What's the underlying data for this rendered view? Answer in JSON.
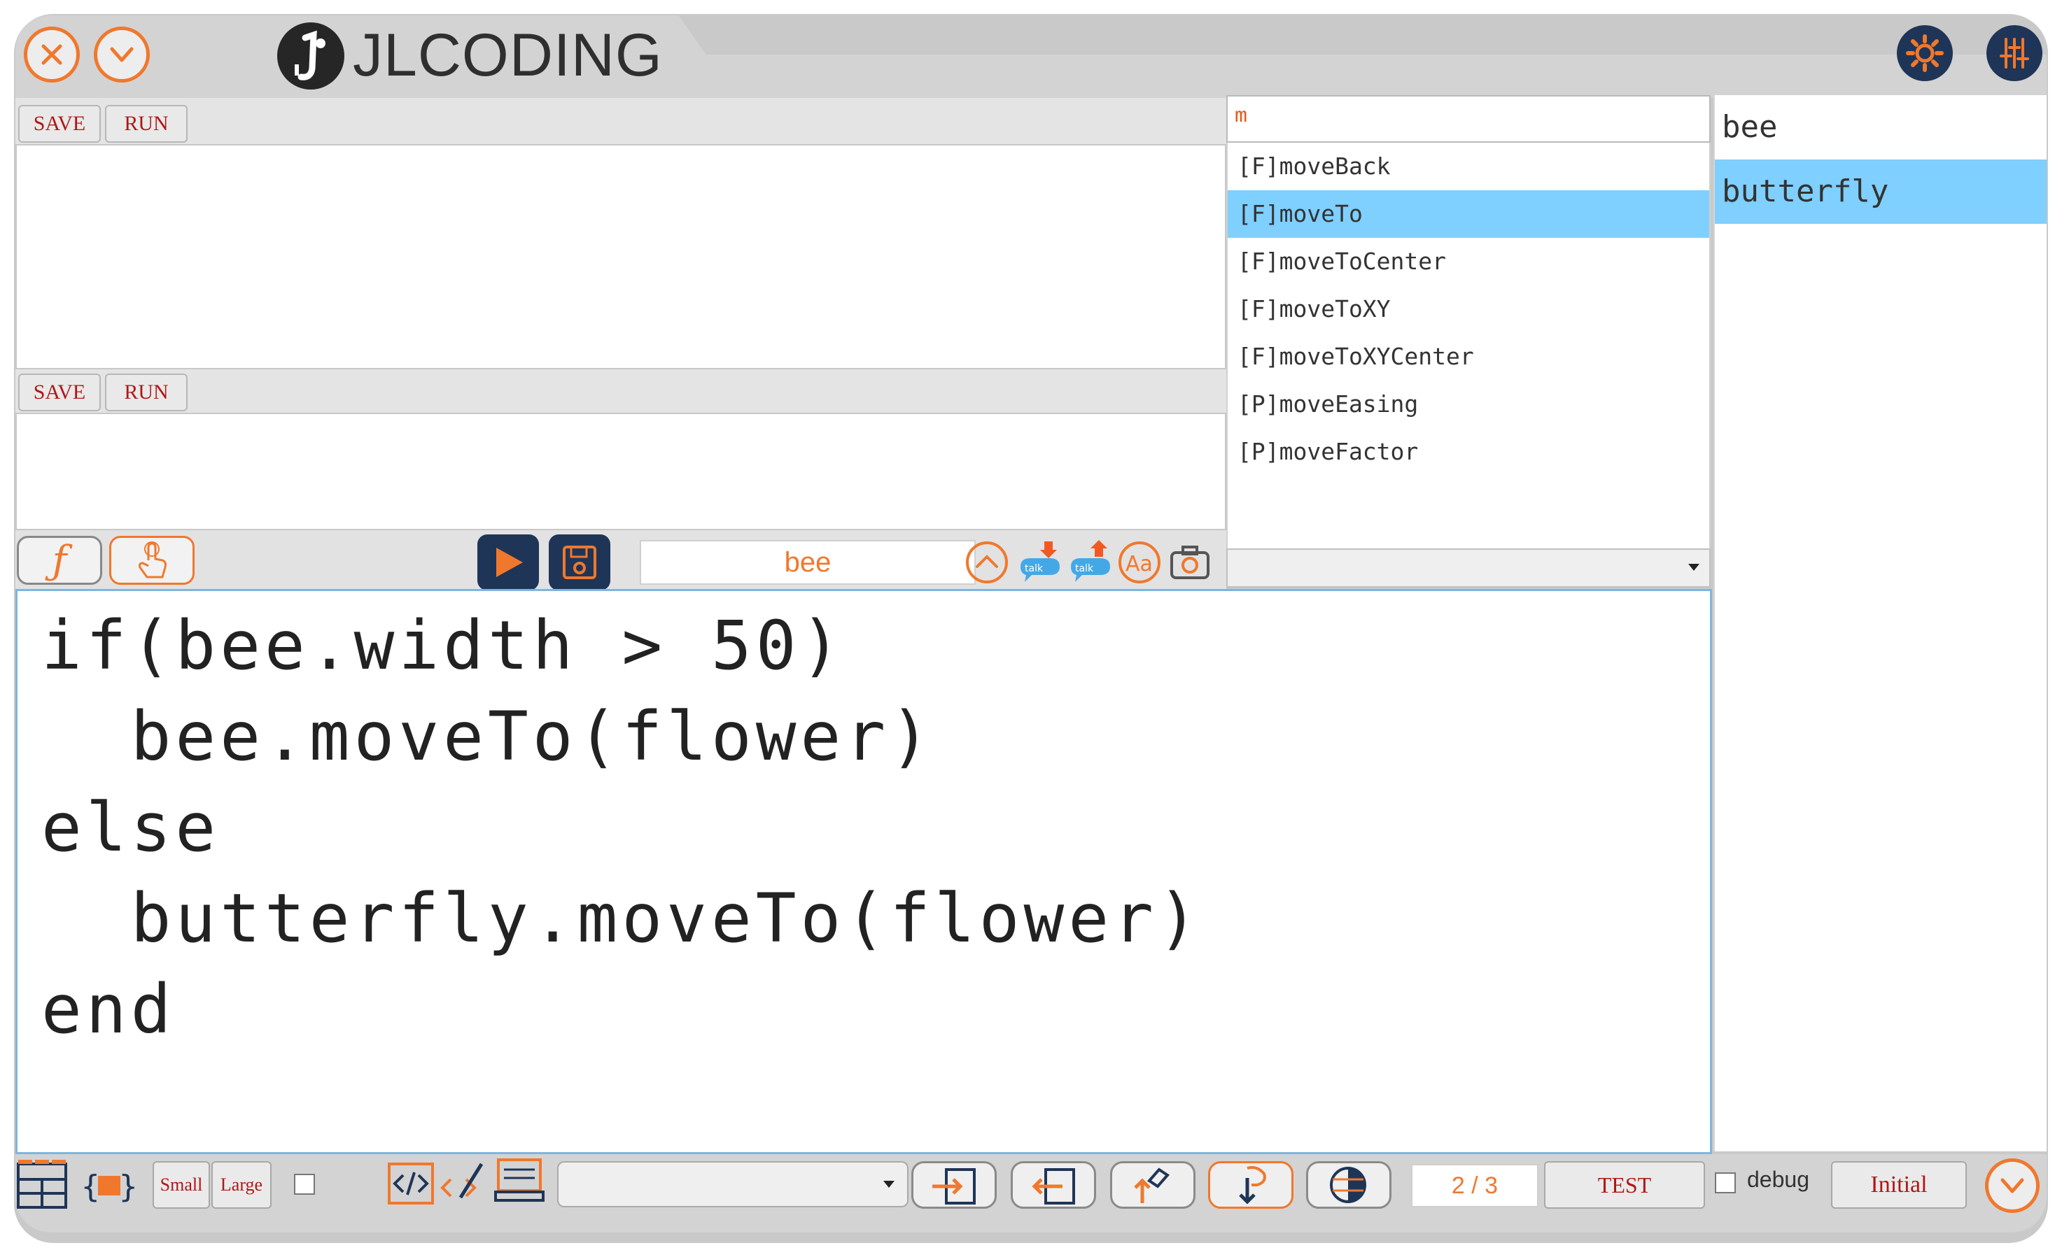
{
  "app": {
    "title": "JLCODING"
  },
  "panels": [
    {
      "save_label": "SAVE",
      "run_label": "RUN"
    },
    {
      "save_label": "SAVE",
      "run_label": "RUN"
    }
  ],
  "autocomplete": {
    "query": "m",
    "items": [
      {
        "label": "[F]moveBack",
        "selected": false
      },
      {
        "label": "[F]moveTo",
        "selected": true
      },
      {
        "label": "[F]moveToCenter",
        "selected": false
      },
      {
        "label": "[F]moveToXY",
        "selected": false
      },
      {
        "label": "[F]moveToXYCenter",
        "selected": false
      },
      {
        "label": "[P]moveEasing",
        "selected": false
      },
      {
        "label": "[P]moveFactor",
        "selected": false
      }
    ]
  },
  "objects": {
    "items": [
      {
        "label": "bee",
        "selected": false
      },
      {
        "label": "butterfly",
        "selected": true
      }
    ]
  },
  "toolbar": {
    "function_glyph": "ƒ",
    "object_name": "bee",
    "talk_label": "talk",
    "font_label": "Aa"
  },
  "code": {
    "lines": [
      "if(bee.width > 50)",
      "  bee.moveTo(flower)",
      "else",
      "  butterfly.moveTo(flower)",
      "end"
    ]
  },
  "bottom": {
    "small_label": "Small",
    "large_label": "Large",
    "page_indicator": "2 / 3",
    "test_label": "TEST",
    "debug_label": "debug",
    "initial_label": "Initial"
  },
  "colors": {
    "accent": "#f0782d",
    "navy": "#1f3557",
    "selection": "#7fcfff",
    "button_text": "#b01717"
  }
}
